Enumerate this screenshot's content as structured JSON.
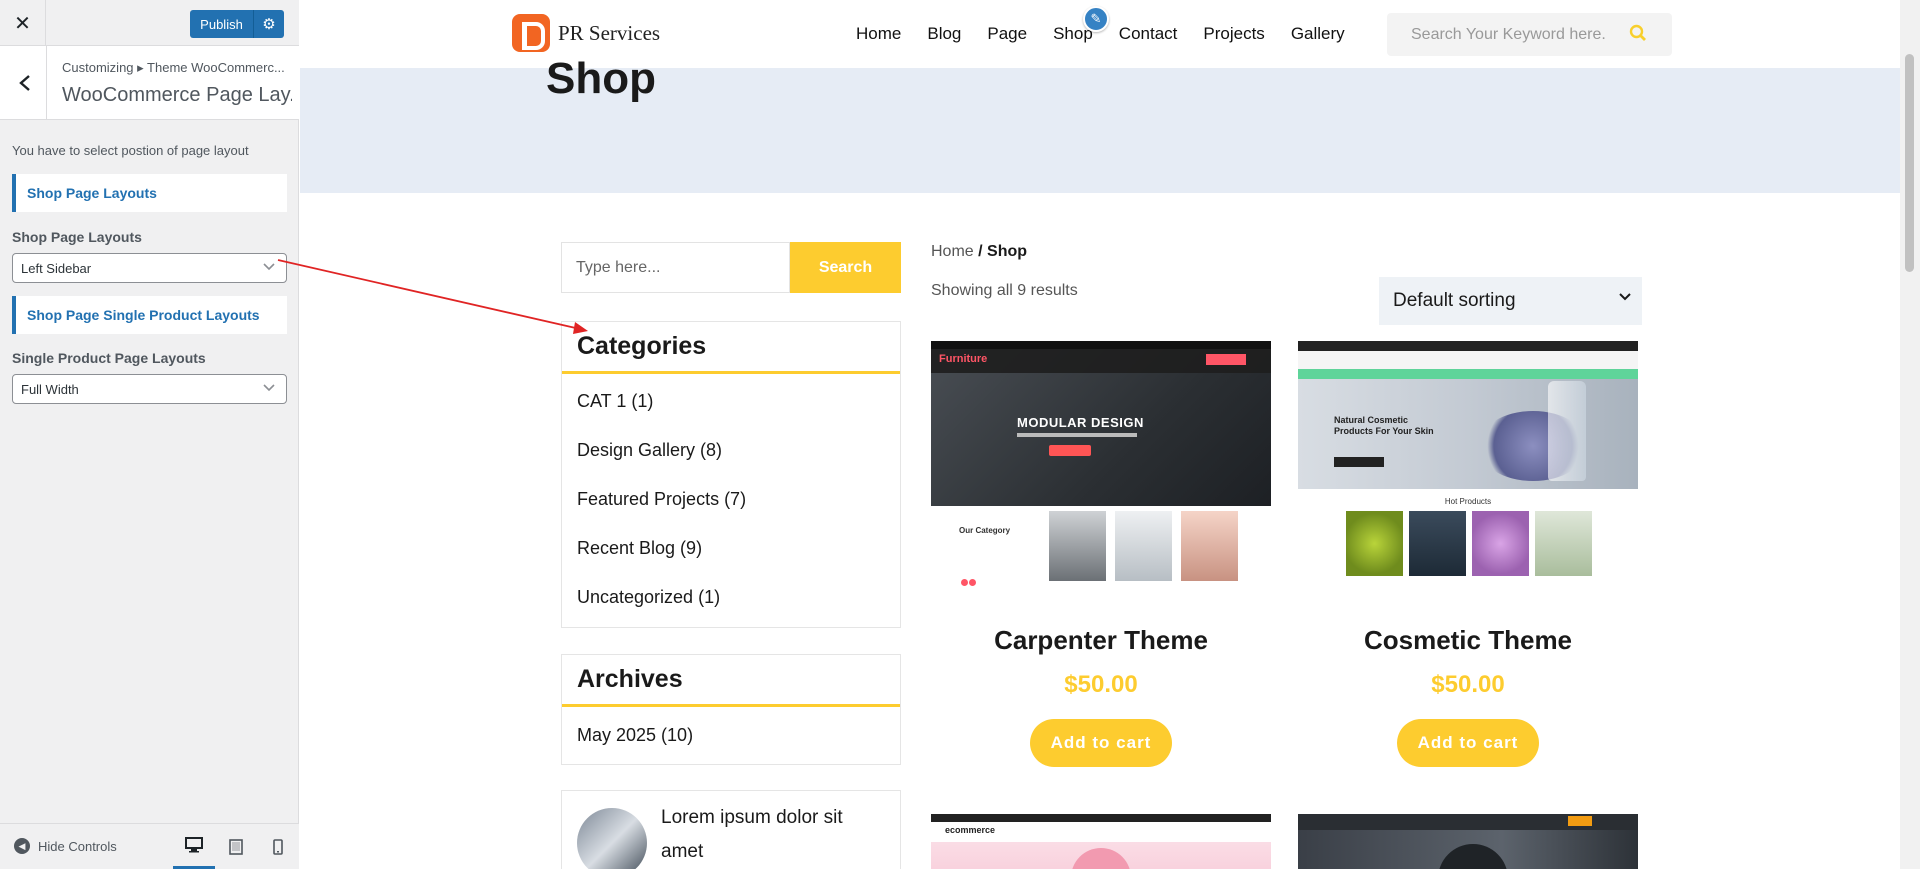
{
  "customizer": {
    "close_label": "✕",
    "publish_label": "Publish",
    "gear_glyph": "⚙",
    "back_glyph": "‹",
    "breadcrumb": "Customizing ▸ Theme WooCommerc...",
    "section_title": "WooCommerce Page Lay...",
    "description": "You have to select postion of page layout",
    "shop_heading": "Shop Page Layouts",
    "shop_label": "Shop Page Layouts",
    "shop_select_value": "Left Sidebar",
    "single_heading": "Shop Page Single Product Layouts",
    "single_label": "Single Product Page Layouts",
    "single_select_value": "Full Width",
    "hide_controls": "Hide Controls",
    "accent_color": "#2271b1"
  },
  "site": {
    "brand": "PR Services",
    "nav": [
      "Home",
      "Blog",
      "Page",
      "Shop",
      "Contact",
      "Projects",
      "Gallery"
    ],
    "search_placeholder": "Search Your Keyword here.",
    "banner_title": "Shop",
    "accent_color": "#fdcc2f"
  },
  "sidebar": {
    "search_placeholder": "Type here...",
    "search_button": "Search",
    "categories_title": "Categories",
    "categories": [
      "CAT 1 (1)",
      "Design Gallery (8)",
      "Featured Projects (7)",
      "Recent Blog (9)",
      "Uncategorized (1)"
    ],
    "archives_title": "Archives",
    "archives": [
      "May 2025 (10)"
    ],
    "recent_post_title": "Lorem ipsum dolor sit amet"
  },
  "shop": {
    "breadcrumb_home": "Home",
    "breadcrumb_sep": " / ",
    "breadcrumb_current": "Shop",
    "results": "Showing all 9 results",
    "sorting": "Default sorting",
    "products": [
      {
        "name": "Carpenter Theme",
        "price": "$50.00",
        "button": "Add to cart",
        "thumb": {
          "logo": "Furniture",
          "headline": "MODULAR DESIGN",
          "section": "Our Category"
        }
      },
      {
        "name": "Cosmetic Theme",
        "price": "$50.00",
        "button": "Add to cart",
        "thumb": {
          "heading": "Natural Cosmetic Products For Your Skin",
          "section": "Hot Products"
        }
      }
    ],
    "partial_products": [
      {
        "thumb_logo": "ecommerce"
      }
    ]
  }
}
